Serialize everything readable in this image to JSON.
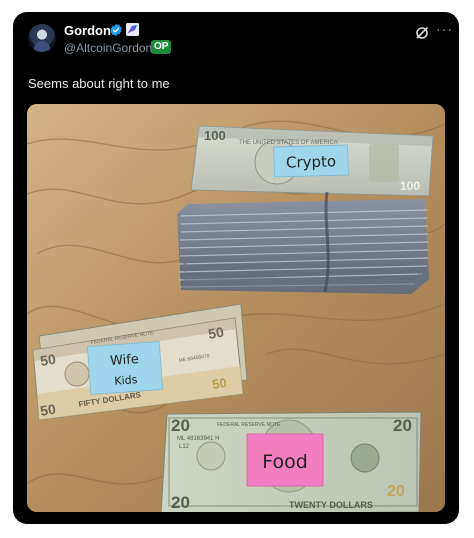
{
  "tweet": {
    "author_name": "Gordon",
    "handle": "@AltcoinGordon",
    "op_badge": "OP",
    "text": "Seems about right to me",
    "more_label": "···"
  },
  "photo": {
    "sticky_notes": {
      "crypto": "Crypto",
      "wife": "Wife",
      "kids": "Kids",
      "food": "Food"
    },
    "bill_print": {
      "hundred_corner": "100",
      "hundred_banner": "THE UNITED STATES OF AMERICA",
      "fifty_corner": "50",
      "fifty_bottom": "FIFTY DOLLARS",
      "fifty_top_text": "FEDERAL RESERVE NOTE",
      "fifty_serial": "ME 66455078",
      "twenty_corner": "20",
      "twenty_top_text": "FEDERAL RESERVE NOTE",
      "twenty_serial": "ML 48163941 H",
      "twenty_bottom": "TWENTY DOLLARS",
      "twenty_mark": "L12"
    }
  },
  "colors": {
    "card_bg": "#000000",
    "verified": "#1d9bf0",
    "op_badge": "#1f8a3a",
    "note_blue": "#9fd6ec",
    "note_pink": "#f37fc0"
  }
}
